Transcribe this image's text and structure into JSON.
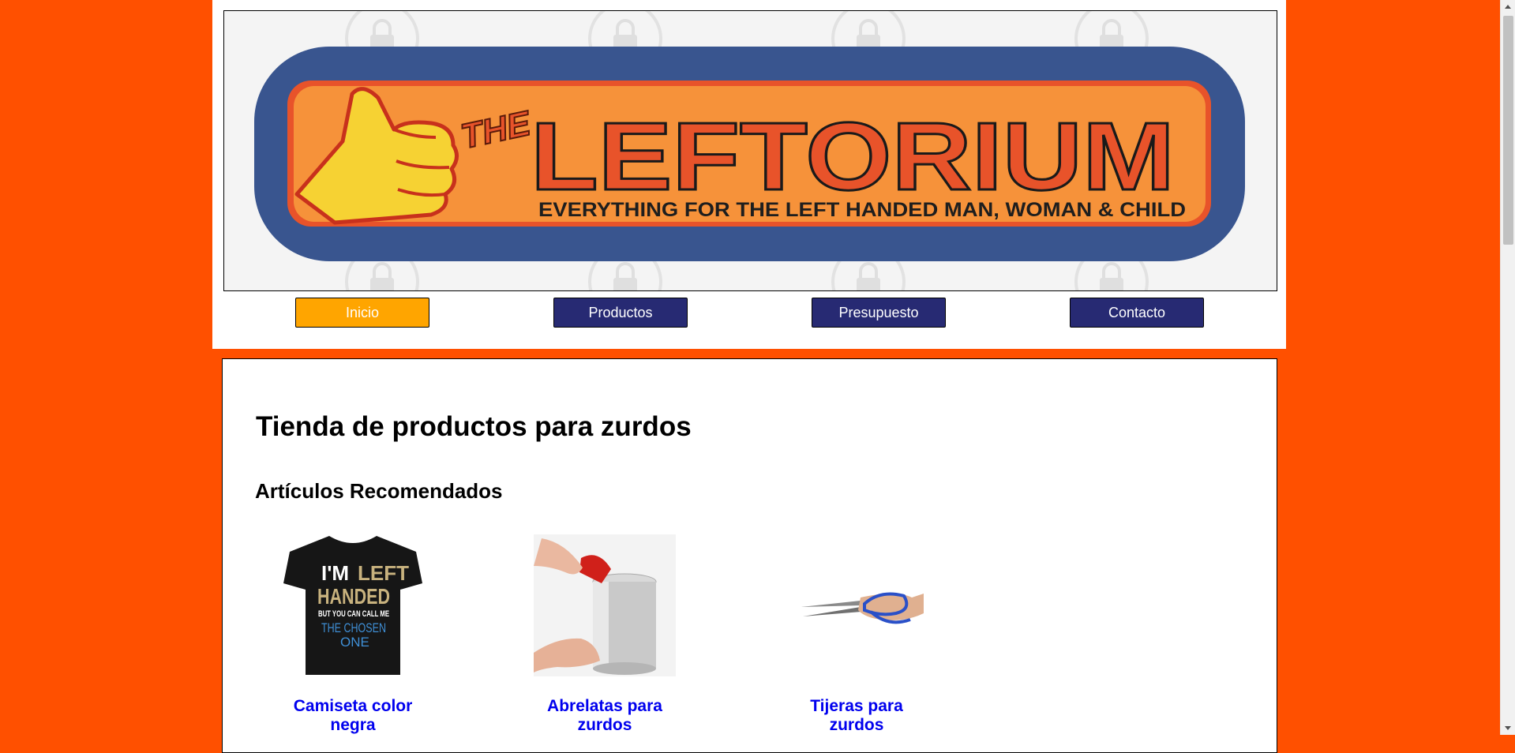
{
  "banner": {
    "logo_the": "THE",
    "logo_word": "LEFTORIUM",
    "logo_tagline": "EVERYTHING FOR THE LEFT HANDED MAN, WOMAN & CHILD",
    "watermark_icon": "lock-icon"
  },
  "nav": {
    "items": [
      {
        "label": "Inicio",
        "active": true
      },
      {
        "label": "Productos",
        "active": false
      },
      {
        "label": "Presupuesto",
        "active": false
      },
      {
        "label": "Contacto",
        "active": false
      }
    ]
  },
  "main": {
    "title": "Tienda de productos para zurdos",
    "section_title": "Artículos Recomendados",
    "products": [
      {
        "name": "Camiseta color negra",
        "image": "tshirt-image",
        "shirt_lines": [
          "I'M",
          "LEFT",
          "HANDED",
          "BUT YOU CAN CALL ME",
          "THE CHOSEN",
          "ONE"
        ]
      },
      {
        "name": "Abrelatas para zurdos",
        "image": "can-opener-image"
      },
      {
        "name": "Tijeras para zurdos",
        "image": "scissors-image"
      }
    ]
  },
  "colors": {
    "page_background": "#ff5000",
    "nav_button": "#272a73",
    "nav_active": "#ffa500",
    "link": "#0000ee"
  }
}
